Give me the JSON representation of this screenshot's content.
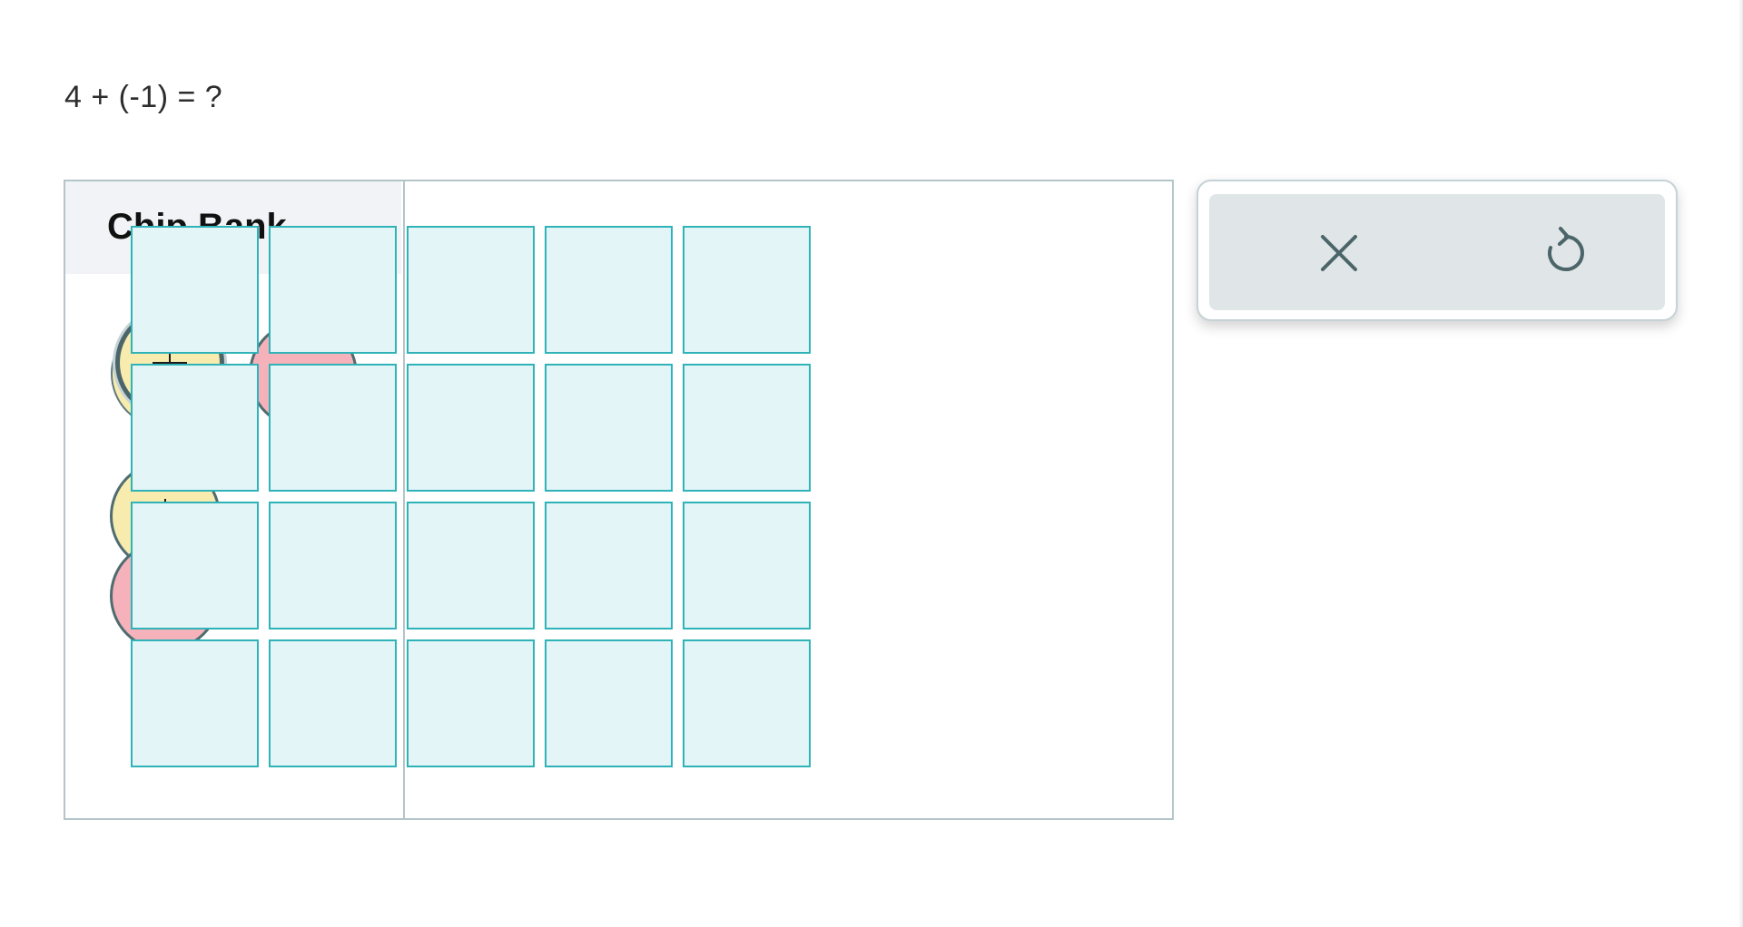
{
  "question": {
    "text": "4 + (-1) = ?"
  },
  "chip_bank": {
    "title": "Chip Bank",
    "chips": [
      {
        "kind": "positive",
        "symbol": "+",
        "label": "positive chip"
      },
      {
        "kind": "negative",
        "symbol": "−",
        "label": "negative chip"
      }
    ]
  },
  "mat": {
    "rows": 4,
    "columns": 5
  },
  "toolbar": {
    "buttons": [
      {
        "name": "clear",
        "icon": "close-icon"
      },
      {
        "name": "reset",
        "icon": "redo-icon"
      }
    ]
  },
  "colors": {
    "positive_chip": "#f8ebae",
    "negative_chip": "#f6b2ba",
    "chip_border": "#4f6c70",
    "cell_fill": "#e4f5f7",
    "cell_border": "#2fb3b8",
    "icon": "#4b6569"
  }
}
